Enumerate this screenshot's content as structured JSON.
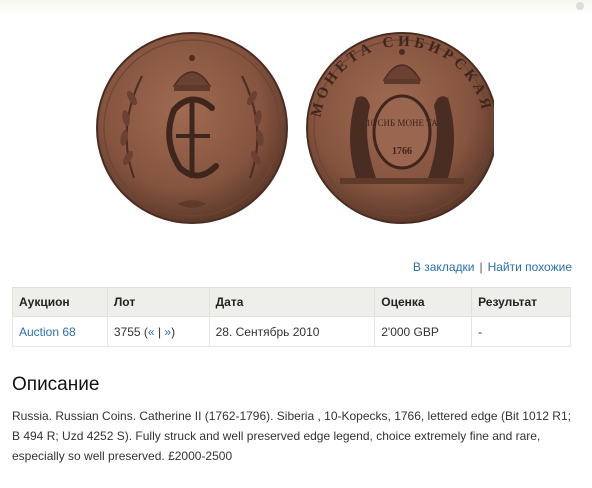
{
  "actions": {
    "bookmark_label": "В закладки",
    "separator": "|",
    "find_similar_label": "Найти похожие"
  },
  "lot_table": {
    "headers": [
      "Аукцион",
      "Лот",
      "Дата",
      "Оценка",
      "Результат"
    ],
    "row": {
      "auction": "Auction 68",
      "lot_number": "3755",
      "lot_prev": "«",
      "lot_sep": "|",
      "lot_next": "»",
      "date": "28. Сентябрь 2010",
      "estimate": "2'000 GBP",
      "result": "-"
    }
  },
  "description": {
    "title": "Описание",
    "text": "Russia. Russian Coins. Catherine II (1762-1796). Siberia , 10-Kopecks, 1766, lettered edge (Bit 1012 R1; B 494 R; Uzd 4252 S). Fully struck and well preserved edge legend, choice extremely fine and rare, especially so well preserved. £2000-2500"
  },
  "coin": {
    "reverse_legend": "МОНЕТА СИБИРСКАЯ",
    "reverse_shield": "10 СИБ МОНЕ ТА",
    "reverse_year": "1766"
  },
  "colors": {
    "link": "#2a6fb0",
    "table_header_bg": "#eeeeea",
    "coin_bronze": "#8a5a45"
  }
}
